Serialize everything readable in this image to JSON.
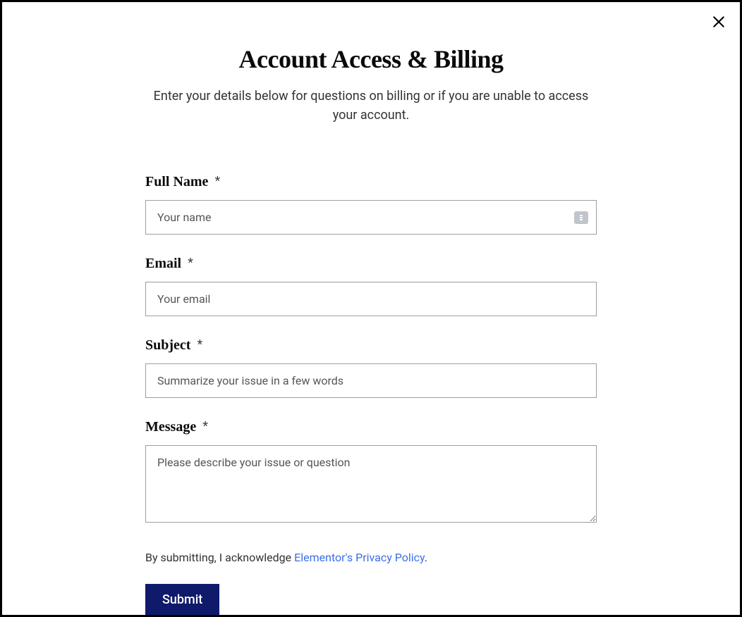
{
  "modal": {
    "title": "Account Access & Billing",
    "subtitle": "Enter your details below for questions on billing or if you are unable to access your account."
  },
  "form": {
    "fullName": {
      "label": "Full Name",
      "required": "*",
      "placeholder": "Your name",
      "value": ""
    },
    "email": {
      "label": "Email",
      "required": "*",
      "placeholder": "Your email",
      "value": ""
    },
    "subject": {
      "label": "Subject",
      "required": "*",
      "placeholder": "Summarize your issue in a few words",
      "value": ""
    },
    "message": {
      "label": "Message",
      "required": "*",
      "placeholder": "Please describe your issue or question",
      "value": ""
    },
    "acknowledgement": {
      "prefix": "By submitting, I acknowledge ",
      "linkText": "Elementor's Privacy Policy",
      "suffix": "."
    },
    "submitLabel": "Submit"
  }
}
